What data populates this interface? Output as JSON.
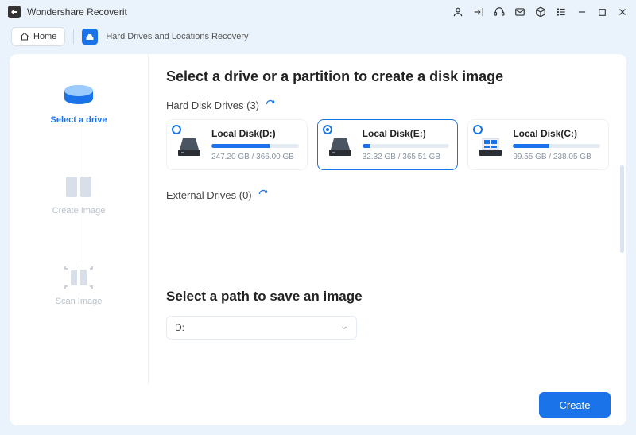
{
  "app": {
    "name": "Wondershare Recoverit"
  },
  "toolbar": {
    "home": "Home",
    "breadcrumb": "Hard Drives and Locations Recovery"
  },
  "sidebar": {
    "step1": "Select a drive",
    "step2": "Create Image",
    "step3": "Scan Image"
  },
  "main": {
    "title": "Select a drive or a partition to create a disk image",
    "hdd_label": "Hard Disk Drives (3)",
    "external_label": "External Drives (0)",
    "drives": [
      {
        "name": "Local Disk(D:)",
        "size": "247.20 GB / 366.00 GB",
        "fill": 67,
        "selected": false,
        "os": false
      },
      {
        "name": "Local Disk(E:)",
        "size": "32.32 GB / 365.51 GB",
        "fill": 9,
        "selected": true,
        "os": false
      },
      {
        "name": "Local Disk(C:)",
        "size": "99.55 GB / 238.05 GB",
        "fill": 42,
        "selected": false,
        "os": true
      }
    ],
    "path_title": "Select a path to save an image",
    "path_value": "D:"
  },
  "footer": {
    "create": "Create"
  }
}
